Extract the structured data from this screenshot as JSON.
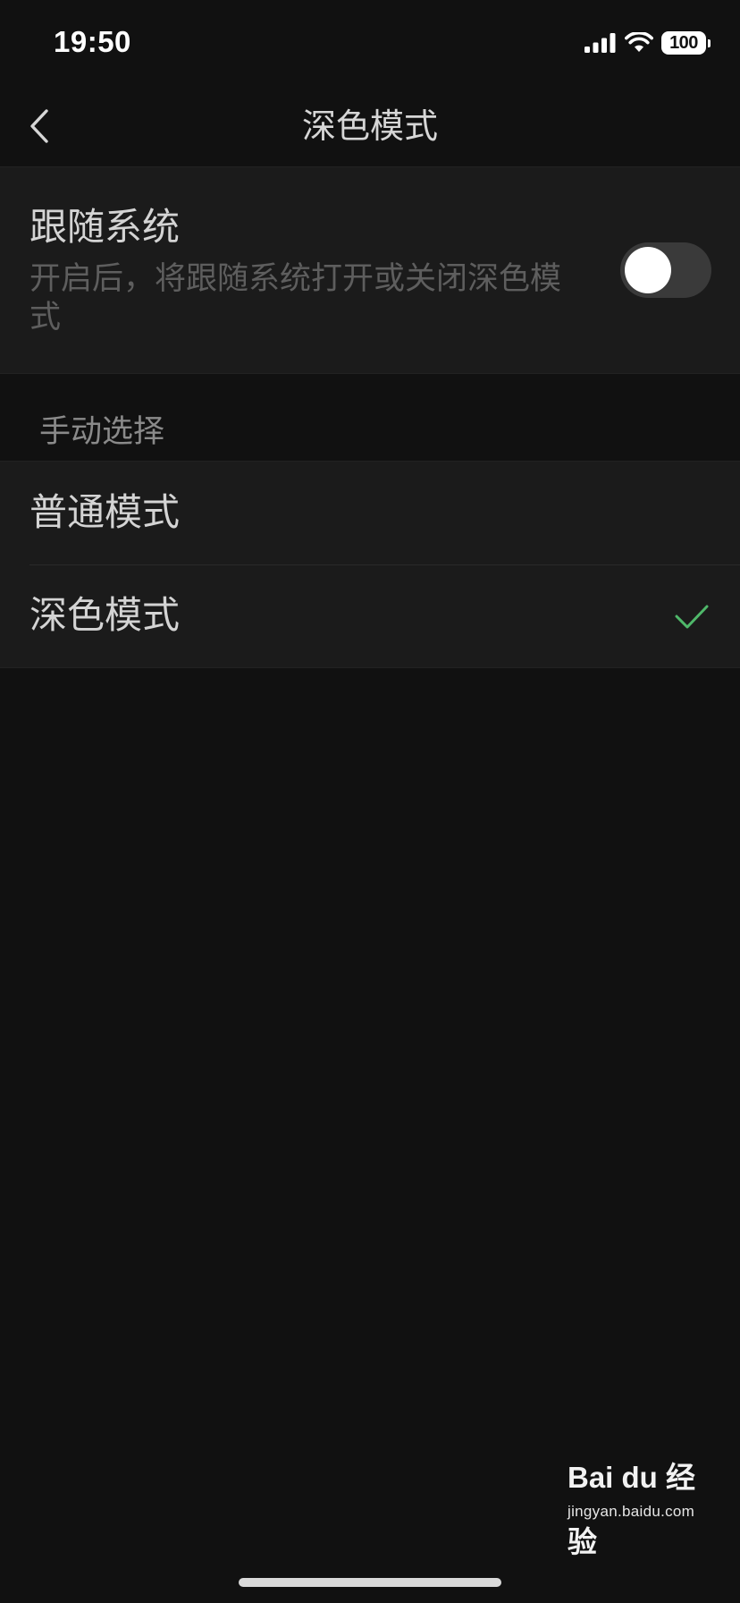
{
  "status_bar": {
    "time": "19:50",
    "battery": "100",
    "icons": [
      "signal-icon",
      "wifi-icon",
      "battery-icon"
    ]
  },
  "nav": {
    "title": "深色模式",
    "back_icon": "chevron-left-icon"
  },
  "follow_system": {
    "title": "跟随系统",
    "description": "开启后，将跟随系统打开或关闭深色模式",
    "enabled": false
  },
  "manual": {
    "section_title": "手动选择",
    "options": [
      {
        "label": "普通模式",
        "selected": false
      },
      {
        "label": "深色模式",
        "selected": true
      }
    ]
  },
  "watermark": {
    "logo": "Bai du 经验",
    "url": "jingyan.baidu.com"
  },
  "colors": {
    "background": "#111111",
    "card": "#1b1b1b",
    "accent_check": "#4fb86a",
    "toggle_off": "#3a3a3a"
  }
}
